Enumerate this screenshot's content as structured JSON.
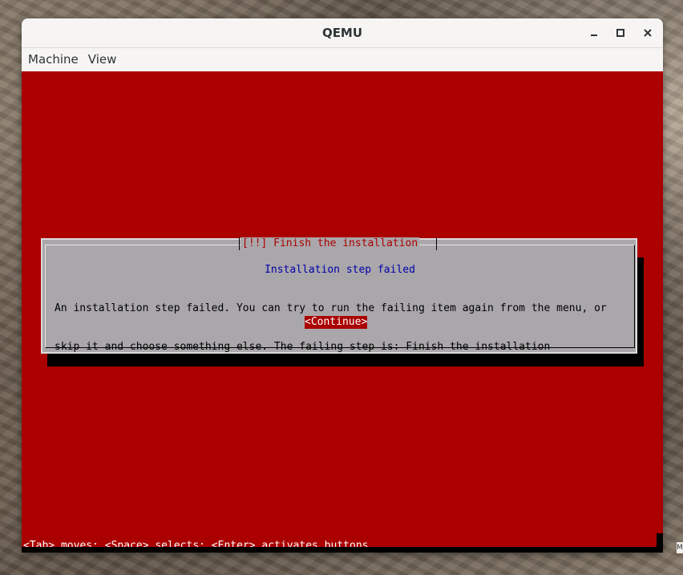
{
  "window": {
    "title": "QEMU"
  },
  "menu": {
    "items": [
      {
        "label": "Machine"
      },
      {
        "label": "View"
      }
    ]
  },
  "dialog": {
    "title": "[!!] Finish the installation",
    "heading": "Installation step failed",
    "body_lines": [
      "An installation step failed. You can try to run the failing item again from the menu, or",
      "skip it and choose something else. The failing step is: Finish the installation"
    ],
    "button_label": "<Continue>"
  },
  "status": {
    "text": "<Tab> moves; <Space> selects; <Enter> activates buttons"
  },
  "desktop": {
    "edge_text": "M"
  },
  "colors": {
    "screen_background": "#aa0000",
    "dialog_background": "#aaa7ab",
    "heading_text": "#0000aa"
  }
}
